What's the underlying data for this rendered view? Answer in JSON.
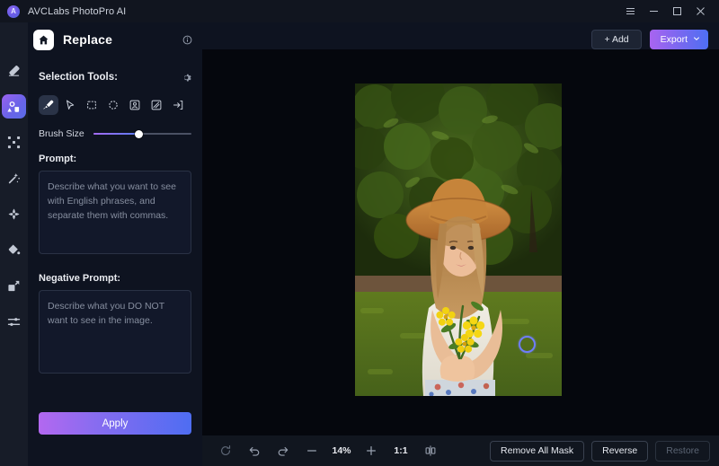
{
  "titlebar": {
    "app_name": "AVCLabs PhotoPro AI",
    "logo_icon": "app-logo-icon",
    "menu_icon": "hamburger-menu-icon",
    "minimize_icon": "minimize-icon",
    "maximize_icon": "maximize-icon",
    "close_icon": "close-icon"
  },
  "rail": {
    "items": [
      {
        "name": "eraser",
        "icon": "eraser-icon",
        "active": false
      },
      {
        "name": "replace",
        "icon": "replace-icon",
        "active": true
      },
      {
        "name": "expand",
        "icon": "expand-icon",
        "active": false
      },
      {
        "name": "magic-wand",
        "icon": "magic-wand-icon",
        "active": false
      },
      {
        "name": "enhance",
        "icon": "enhance-icon",
        "active": false
      },
      {
        "name": "color-fill",
        "icon": "paint-bucket-icon",
        "active": false
      },
      {
        "name": "resize",
        "icon": "resize-icon",
        "active": false
      },
      {
        "name": "adjust",
        "icon": "adjust-sliders-icon",
        "active": false
      }
    ]
  },
  "header": {
    "home_icon": "home-icon",
    "title": "Replace",
    "info_icon": "info-icon"
  },
  "panel": {
    "selection_tools_label": "Selection Tools:",
    "settings_icon": "gear-icon",
    "tools": [
      {
        "name": "brush",
        "icon": "brush-icon",
        "active": true
      },
      {
        "name": "lasso",
        "icon": "cursor-arrow-icon",
        "active": false
      },
      {
        "name": "rectangle",
        "icon": "rectangle-icon",
        "active": false
      },
      {
        "name": "ellipse",
        "icon": "ellipse-icon",
        "active": false
      },
      {
        "name": "subject",
        "icon": "portrait-icon",
        "active": false
      },
      {
        "name": "background",
        "icon": "background-icon",
        "active": false
      },
      {
        "name": "import-mask",
        "icon": "import-mask-icon",
        "active": false
      }
    ],
    "brush_size_label": "Brush Size",
    "brush_size_percent": 46,
    "prompt_label": "Prompt:",
    "prompt_value": "",
    "prompt_placeholder": "Describe what you want to see with English phrases, and separate them with commas.",
    "negative_prompt_label": "Negative Prompt:",
    "negative_prompt_value": "",
    "negative_prompt_placeholder": "Describe what you DO NOT want to see in the image.",
    "apply_label": "Apply"
  },
  "topbar": {
    "add_label": "+ Add",
    "export_label": "Export",
    "export_caret_icon": "chevron-down-icon"
  },
  "canvas": {
    "brush_cursor_icon": "brush-cursor-circle"
  },
  "bottom": {
    "reset_icon": "reset-icon",
    "undo_icon": "undo-icon",
    "redo_icon": "redo-icon",
    "zoom_out_icon": "minus-icon",
    "zoom_level": "14%",
    "zoom_in_icon": "plus-icon",
    "fit_label": "1:1",
    "compare_icon": "compare-split-icon",
    "remove_all_mask_label": "Remove All Mask",
    "reverse_label": "Reverse",
    "restore_label": "Restore"
  },
  "colors": {
    "accent_purple": "#a964f0",
    "accent_blue": "#4e6ff2",
    "panel_bg": "#0e1320",
    "rail_bg": "#171c28",
    "canvas_bg": "#05070d",
    "titlebar_bg": "#11151f"
  }
}
